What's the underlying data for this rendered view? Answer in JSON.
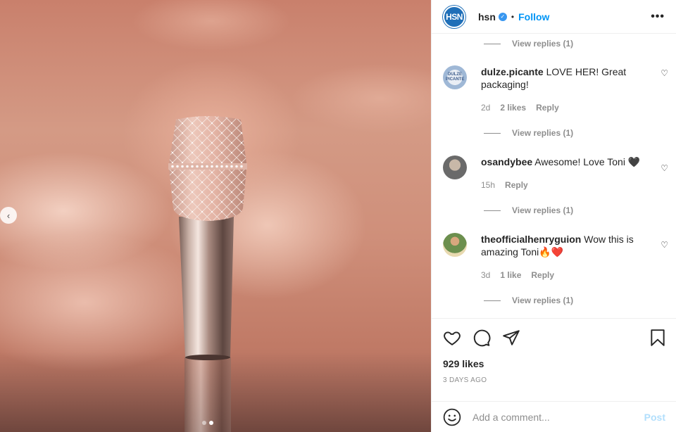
{
  "header": {
    "username": "hsn",
    "avatar_text": "HSN",
    "separator": "•",
    "follow_label": "Follow",
    "more_label": "•••"
  },
  "comments": [
    {
      "username": "dulze.picante",
      "text": "LOVE HER! Great packaging!",
      "avatar_text": "DULZE PICANTE",
      "time": "2d",
      "likes": "2 likes",
      "reply": "Reply"
    },
    {
      "username": "osandybee",
      "text": "Awesome! Love Toni 🖤",
      "time": "15h",
      "likes": "",
      "reply": "Reply"
    },
    {
      "username": "theofficialhenryguion",
      "text": "Wow this is amazing Toni🔥❤️",
      "time": "3d",
      "likes": "1 like",
      "reply": "Reply"
    }
  ],
  "view_replies_label": "View replies (1)",
  "actions": {
    "like_icon": "heart-outline-icon",
    "comment_icon": "comment-bubble-icon",
    "share_icon": "paper-plane-icon",
    "save_icon": "bookmark-icon"
  },
  "likes_count": "929 likes",
  "post_date": "3 DAYS AGO",
  "add_comment": {
    "placeholder": "Add a comment...",
    "post_label": "Post"
  },
  "carousel": {
    "prev_label": "‹",
    "slide_count": 2,
    "active_slide": 2
  },
  "colors": {
    "accent": "#0095f6",
    "post_disabled": "#b2dffc",
    "verified": "#3897f0",
    "muted": "#8e8e8e"
  }
}
